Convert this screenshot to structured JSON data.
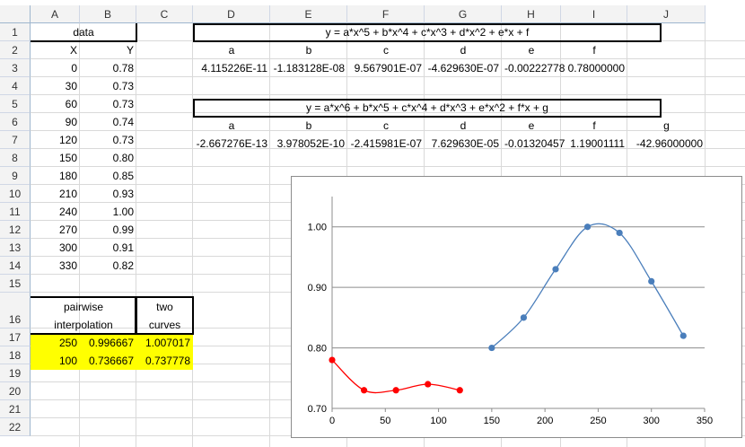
{
  "columns": [
    "A",
    "B",
    "C",
    "D",
    "E",
    "F",
    "G",
    "H",
    "I",
    "J"
  ],
  "rows": [
    "1",
    "2",
    "3",
    "4",
    "5",
    "6",
    "7",
    "8",
    "9",
    "10",
    "11",
    "12",
    "13",
    "14",
    "15",
    "16",
    "17",
    "18",
    "19",
    "20",
    "21",
    "22"
  ],
  "data_header": "data",
  "col_x": "X",
  "col_y": "Y",
  "x_values": [
    "0",
    "30",
    "60",
    "90",
    "120",
    "150",
    "180",
    "210",
    "240",
    "270",
    "300",
    "330"
  ],
  "y_values": [
    "0.78",
    "0.73",
    "0.73",
    "0.74",
    "0.73",
    "0.80",
    "0.85",
    "0.93",
    "1.00",
    "0.99",
    "0.91",
    "0.82"
  ],
  "pairwise_label_1": "pairwise",
  "pairwise_label_2": "interpolation",
  "two_curves_1": "two",
  "two_curves_2": "curves",
  "r17": [
    "250",
    "0.996667",
    "1.007017"
  ],
  "r18": [
    "100",
    "0.736667",
    "0.737778"
  ],
  "formula1": "y = a*x^5 + b*x^4 + c*x^3 + d*x^2 + e*x + f",
  "coef1_names": [
    "a",
    "b",
    "c",
    "d",
    "e",
    "f"
  ],
  "coef1_values": [
    "4.115226E-11",
    "-1.183128E-08",
    "9.567901E-07",
    "-4.629630E-07",
    "-0.00222778",
    "0.78000000"
  ],
  "formula2": "y = a*x^6 + b*x^5 + c*x^4 + d*x^3 + e*x^2 + f*x + g",
  "coef2_names": [
    "a",
    "b",
    "c",
    "d",
    "e",
    "f",
    "g"
  ],
  "coef2_values": [
    "-2.667276E-13",
    "3.978052E-10",
    "-2.415981E-07",
    "7.629630E-05",
    "-0.01320457",
    "1.19001111",
    "-42.96000000"
  ],
  "chart_data": {
    "type": "scatter",
    "xlim": [
      0,
      350
    ],
    "ylim": [
      0.7,
      1.05
    ],
    "x_ticks": [
      "0",
      "50",
      "100",
      "150",
      "200",
      "250",
      "300",
      "350"
    ],
    "y_ticks": [
      "0.70",
      "0.80",
      "0.90",
      "1.00"
    ],
    "grid": true,
    "series": [
      {
        "color": "#ff0000",
        "x": [
          0,
          30,
          60,
          90,
          120
        ],
        "y": [
          0.78,
          0.73,
          0.73,
          0.74,
          0.73
        ]
      },
      {
        "color": "#4a7ebb",
        "x": [
          150,
          180,
          210,
          240,
          270,
          300,
          330
        ],
        "y": [
          0.8,
          0.85,
          0.93,
          1.0,
          0.99,
          0.91,
          0.82
        ]
      }
    ]
  }
}
